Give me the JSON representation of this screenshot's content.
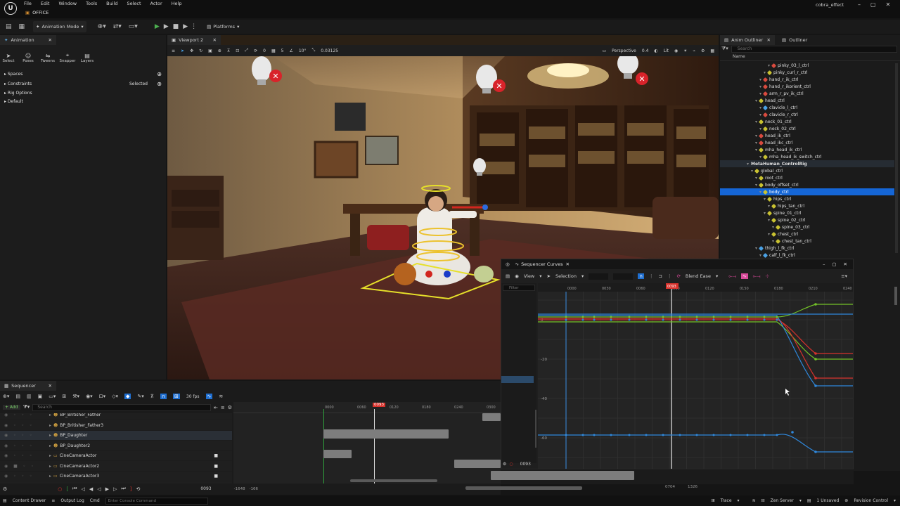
{
  "menu": {
    "items": [
      "File",
      "Edit",
      "Window",
      "Tools",
      "Build",
      "Select",
      "Actor",
      "Help"
    ],
    "project_tab": "OFFICE",
    "window_title": "cobra_effect"
  },
  "toolbar": {
    "mode": "Animation Mode",
    "platforms": "Platforms"
  },
  "animation_panel": {
    "tab": "Animation",
    "tools": [
      "Select",
      "Poses",
      "Tweens",
      "Snapper",
      "Layers"
    ],
    "sections": {
      "spaces": "Spaces",
      "constraints": "Constraints",
      "constraints_value": "Selected",
      "rig_options": "Rig Options",
      "default": "Default"
    }
  },
  "viewport": {
    "tab": "Viewport 2",
    "perspective": "Perspective",
    "lit": "Lit",
    "fov": "0.4",
    "grid": "5",
    "angle": "10°",
    "scale": "0.03125",
    "snap": "0"
  },
  "outliner": {
    "tab_anim": "Anim Outliner",
    "tab_outliner": "Outliner",
    "search_placeholder": "Search",
    "col_name": "Name",
    "rows": [
      {
        "label": "pinky_03_l_ctrl",
        "indent": 7,
        "kind": "red"
      },
      {
        "label": "pinky_curl_r_ctrl",
        "indent": 6,
        "kind": "yellow"
      },
      {
        "label": "hand_r_ik_ctrl",
        "indent": 5,
        "kind": "red"
      },
      {
        "label": "hand_r_ikorient_ctrl",
        "indent": 5,
        "kind": "red"
      },
      {
        "label": "arm_r_pv_ik_ctrl",
        "indent": 5,
        "kind": "red"
      },
      {
        "label": "head_ctrl",
        "indent": 4,
        "kind": "yellow"
      },
      {
        "label": "clavicle_l_ctrl",
        "indent": 5,
        "kind": "blue"
      },
      {
        "label": "clavicle_r_ctrl",
        "indent": 5,
        "kind": "red"
      },
      {
        "label": "neck_01_ctrl",
        "indent": 4,
        "kind": "yellow"
      },
      {
        "label": "neck_02_ctrl",
        "indent": 5,
        "kind": "yellow"
      },
      {
        "label": "head_ik_ctrl",
        "indent": 4,
        "kind": "red"
      },
      {
        "label": "head_ikc_ctrl",
        "indent": 4,
        "kind": "red"
      },
      {
        "label": "mha_head_ik_ctrl",
        "indent": 4,
        "kind": "yellow"
      },
      {
        "label": "mha_head_ik_switch_ctrl",
        "indent": 5,
        "kind": "yellow"
      },
      {
        "label": "MetaHuman_ControlRig",
        "indent": 2,
        "kind": "none"
      },
      {
        "label": "global_ctrl",
        "indent": 3,
        "kind": "yellow"
      },
      {
        "label": "root_ctrl",
        "indent": 4,
        "kind": "yellow"
      },
      {
        "label": "body_offset_ctrl",
        "indent": 4,
        "kind": "yellow"
      },
      {
        "label": "body_ctrl",
        "indent": 5,
        "kind": "yellow"
      },
      {
        "label": "hips_ctrl",
        "indent": 6,
        "kind": "yellow"
      },
      {
        "label": "hips_tan_ctrl",
        "indent": 7,
        "kind": "yellow"
      },
      {
        "label": "spine_01_ctrl",
        "indent": 6,
        "kind": "yellow"
      },
      {
        "label": "spine_02_ctrl",
        "indent": 7,
        "kind": "yellow"
      },
      {
        "label": "spine_03_ctrl",
        "indent": 8,
        "kind": "yellow"
      },
      {
        "label": "chest_ctrl",
        "indent": 7,
        "kind": "yellow"
      },
      {
        "label": "chest_tan_ctrl",
        "indent": 8,
        "kind": "yellow"
      },
      {
        "label": "thigh_l_fk_ctrl",
        "indent": 4,
        "kind": "blue"
      },
      {
        "label": "calf_l_fk_ctrl",
        "indent": 5,
        "kind": "blue"
      }
    ]
  },
  "sequencer": {
    "tab": "Sequencer",
    "add_label": "+ Add",
    "search_placeholder": "Search",
    "fps": "30 fps",
    "current_frame": "0093",
    "range_start": "-1648",
    "range_start2": "-166",
    "range_end": "0704",
    "range_end2": "1326",
    "tracks": [
      "BP_Britisher_Father",
      "BP_Britisher_Father3",
      "BP_Daughter",
      "BP_Daughter2",
      "CineCameraActor",
      "CineCameraActor2",
      "CineCameraActor3"
    ],
    "ruler_ticks": [
      "0000",
      "0060",
      "0120",
      "0180",
      "0240",
      "0300"
    ]
  },
  "curves": {
    "title": "Sequencer Curves",
    "view": "View",
    "selection": "Selection",
    "blend": "Blend Ease",
    "filter_placeholder": "Filter",
    "frame": "0093",
    "ruler_ticks": [
      "0000",
      "0030",
      "0060",
      "0090",
      "0120",
      "0150",
      "0180",
      "0210",
      "0240"
    ],
    "y_labels": [
      "0",
      "-20",
      "-40",
      "-60"
    ],
    "colors": {
      "red": "#d8322c",
      "green": "#73c227",
      "blue": "#2f88dc"
    }
  },
  "statusbar": {
    "content_drawer": "Content Drawer",
    "output_log": "Output Log",
    "cmd": "Cmd",
    "console_placeholder": "Enter Console Command",
    "trace": "Trace",
    "zen_server": "Zen Server",
    "unsaved": "1 Unsaved",
    "revision": "Revision Control"
  }
}
